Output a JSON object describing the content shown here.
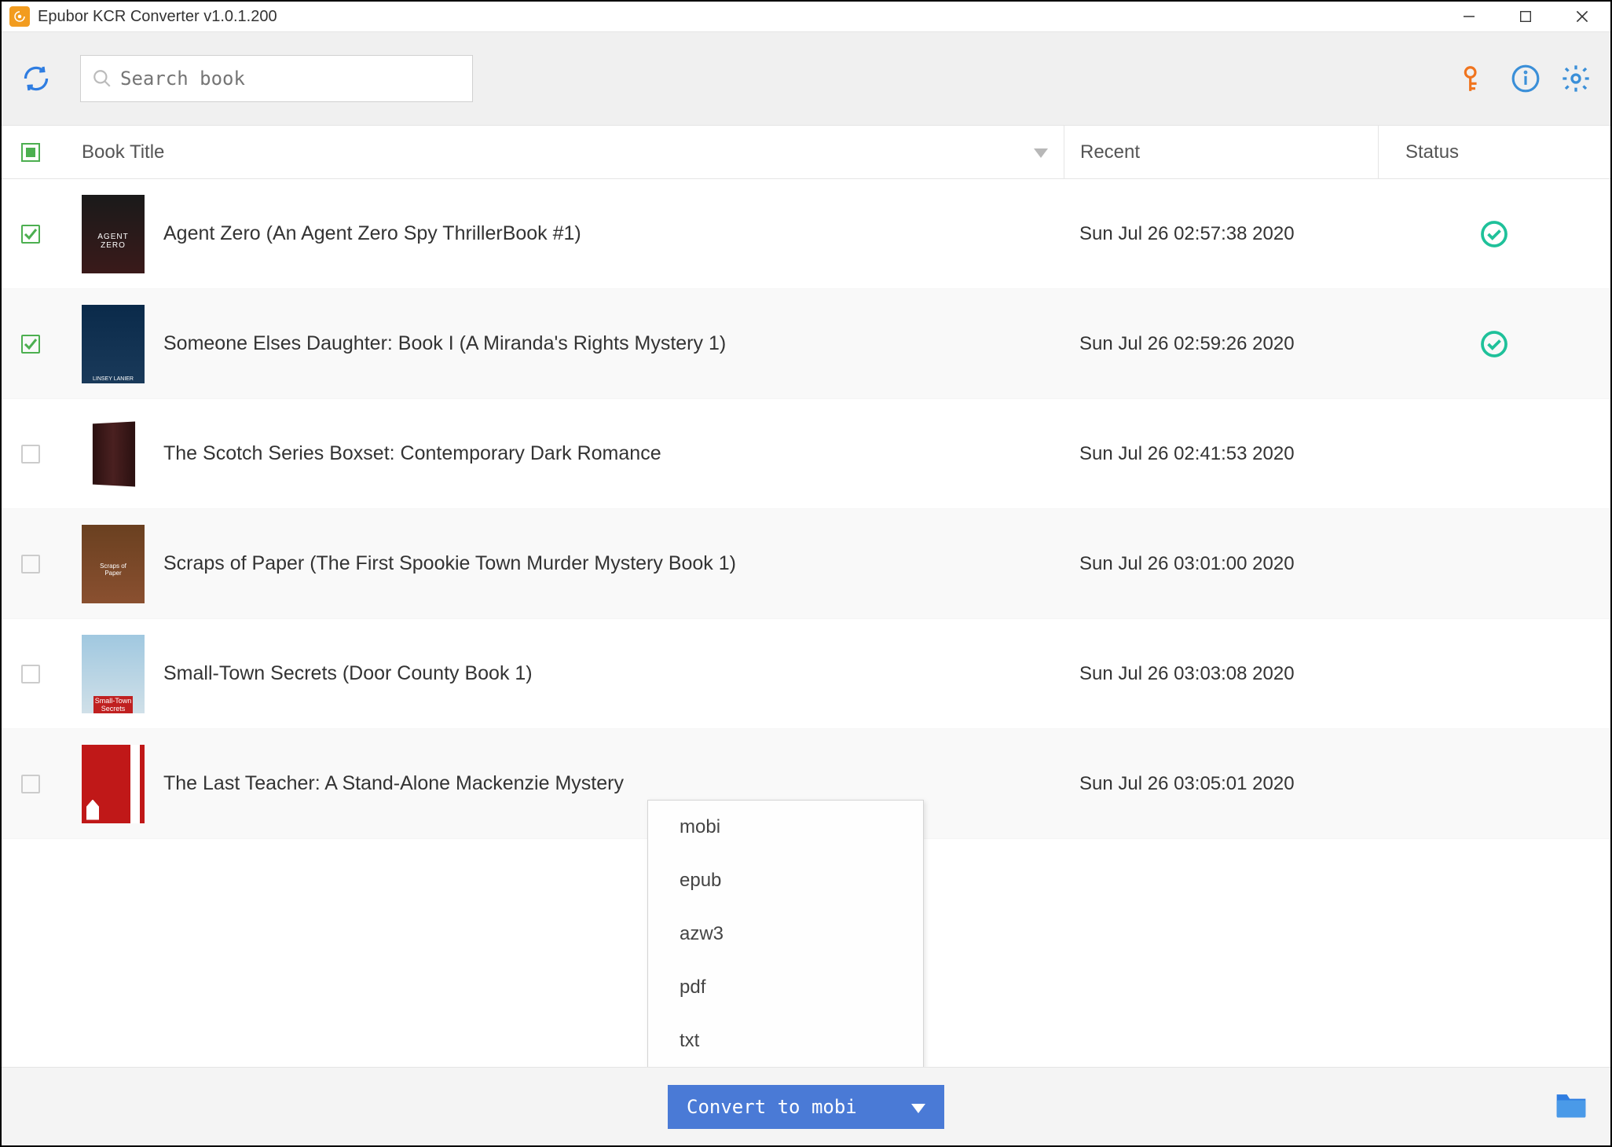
{
  "window": {
    "title": "Epubor KCR Converter v1.0.1.200"
  },
  "toolbar": {
    "search_placeholder": "Search book"
  },
  "columns": {
    "title": "Book Title",
    "recent": "Recent",
    "status": "Status"
  },
  "books": [
    {
      "checked": true,
      "title": "Agent Zero (An Agent Zero Spy ThrillerBook #1)",
      "recent": "Sun Jul 26 02:57:38 2020",
      "status_ok": true
    },
    {
      "checked": true,
      "title": "Someone Elses Daughter: Book I (A Miranda's Rights Mystery 1)",
      "recent": "Sun Jul 26 02:59:26 2020",
      "status_ok": true
    },
    {
      "checked": false,
      "title": "The Scotch Series Boxset: Contemporary Dark Romance",
      "recent": "Sun Jul 26 02:41:53 2020",
      "status_ok": false
    },
    {
      "checked": false,
      "title": "Scraps of Paper (The First Spookie Town Murder Mystery Book 1)",
      "recent": "Sun Jul 26 03:01:00 2020",
      "status_ok": false
    },
    {
      "checked": false,
      "title": "Small-Town Secrets (Door County Book 1)",
      "recent": "Sun Jul 26 03:03:08 2020",
      "status_ok": false
    },
    {
      "checked": false,
      "title": "The Last Teacher: A Stand-Alone Mackenzie Mystery",
      "recent": "Sun Jul 26 03:05:01 2020",
      "status_ok": false
    }
  ],
  "format_menu": {
    "items": [
      "mobi",
      "epub",
      "azw3",
      "pdf",
      "txt"
    ]
  },
  "convert_button": {
    "label": "Convert to mobi"
  }
}
